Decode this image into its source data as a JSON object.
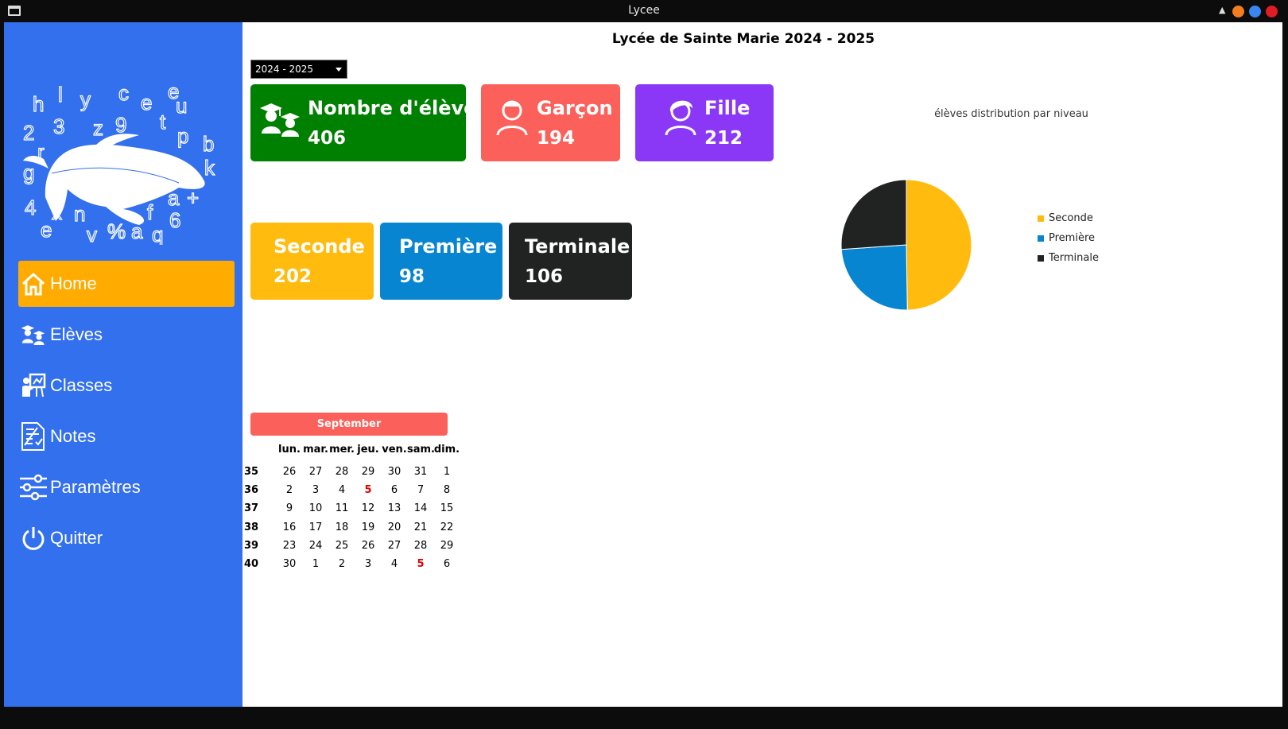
{
  "window": {
    "title": "Lycee"
  },
  "logo": {
    "letters": [
      "h",
      "l",
      "y",
      "c",
      "e",
      "e",
      "u",
      "2",
      "3",
      "z",
      "9",
      "t",
      "p",
      "b",
      "r",
      "k",
      "g",
      "r",
      "b",
      "a",
      "+",
      "4",
      "x",
      "n",
      "f",
      "6",
      "e",
      "v",
      "%",
      "a",
      "q"
    ]
  },
  "sidebar": {
    "items": [
      {
        "label": "Home",
        "icon": "house-icon",
        "active": true
      },
      {
        "label": "Elèves",
        "icon": "students-icon",
        "active": false
      },
      {
        "label": "Classes",
        "icon": "teacher-board-icon",
        "active": false
      },
      {
        "label": "Notes",
        "icon": "notes-document-icon",
        "active": false
      },
      {
        "label": "Paramètres",
        "icon": "sliders-icon",
        "active": false
      },
      {
        "label": "Quitter",
        "icon": "power-icon",
        "active": false
      }
    ]
  },
  "header": {
    "title": "Lycée de Sainte Marie 2024 - 2025"
  },
  "year_select": {
    "value": "2024 - 2025"
  },
  "stats": {
    "total": {
      "label": "Nombre d'élèves",
      "value": "406",
      "color": "#008000",
      "icon": "students-icon"
    },
    "boys": {
      "label": "Garçon",
      "value": "194",
      "color": "#fb605a",
      "icon": "boy-icon"
    },
    "girls": {
      "label": "Fille",
      "value": "212",
      "color": "#8a38f5",
      "icon": "girl-icon"
    },
    "seconde": {
      "label": "Seconde",
      "value": "202",
      "color": "#ffbb0e"
    },
    "premiere": {
      "label": "Première",
      "value": "98",
      "color": "#0885d0"
    },
    "terminale": {
      "label": "Terminale",
      "value": "106",
      "color": "#202322"
    }
  },
  "chart_data": {
    "type": "pie",
    "title": "élèves distribution par niveau",
    "categories": [
      "Seconde",
      "Première",
      "Terminale"
    ],
    "values": [
      202,
      98,
      106
    ],
    "colors": [
      "#ffbb0e",
      "#0885d0",
      "#202322"
    ],
    "legend": "right"
  },
  "calendar": {
    "month": "September",
    "day_names": [
      "lun.",
      "mar.",
      "mer.",
      "jeu.",
      "ven.",
      "sam.",
      "dim."
    ],
    "weeks": [
      {
        "num": "35",
        "days": [
          "26",
          "27",
          "28",
          "29",
          "30",
          "31",
          "1"
        ]
      },
      {
        "num": "36",
        "days": [
          "2",
          "3",
          "4",
          "5",
          "6",
          "7",
          "8"
        ]
      },
      {
        "num": "37",
        "days": [
          "9",
          "10",
          "11",
          "12",
          "13",
          "14",
          "15"
        ]
      },
      {
        "num": "38",
        "days": [
          "16",
          "17",
          "18",
          "19",
          "20",
          "21",
          "22"
        ]
      },
      {
        "num": "39",
        "days": [
          "23",
          "24",
          "25",
          "26",
          "27",
          "28",
          "29"
        ]
      },
      {
        "num": "40",
        "days": [
          "30",
          "1",
          "2",
          "3",
          "4",
          "5",
          "6"
        ]
      }
    ],
    "highlight_color": "#e00000"
  }
}
